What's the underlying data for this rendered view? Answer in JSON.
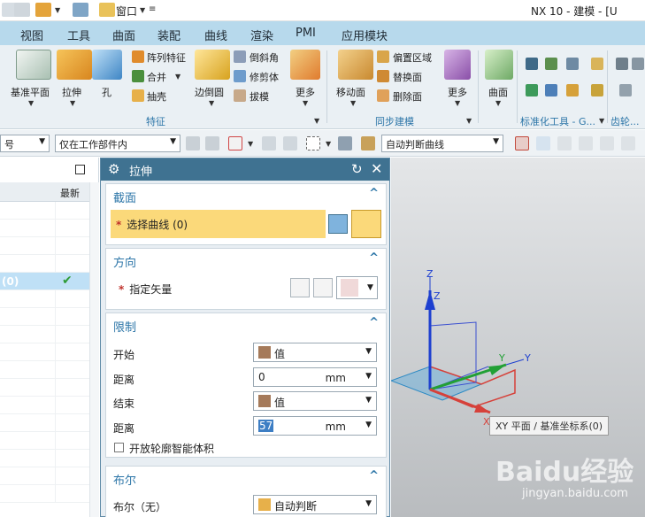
{
  "window": {
    "title": "NX 10 - 建模 - [U",
    "quick_access_window_label": "窗口"
  },
  "tabs": [
    "视图",
    "工具",
    "曲面",
    "装配",
    "曲线",
    "渲染",
    "PMI",
    "应用模块"
  ],
  "ribbon": {
    "datum_plane": "基准平面",
    "extrude": "拉伸",
    "hole": "孔",
    "pattern_feature": "阵列特征",
    "unite": "合并",
    "shell": "抽壳",
    "edge_blend": "边倒圆",
    "chamfer": "倒斜角",
    "trim_body": "修剪体",
    "draft": "拔模",
    "more1": "更多",
    "move_face": "移动面",
    "offset_region": "偏置区域",
    "replace_face": "替换面",
    "delete_face": "删除面",
    "more2": "更多",
    "surface": "曲面",
    "group_feature": "特征",
    "group_sync": "同步建模",
    "group_std": "标准化工具 - G...",
    "group_gear": "齿轮..."
  },
  "selection_bar": {
    "filter_left": "号",
    "scope": "仅在工作部件内",
    "curve_rule": "自动判断曲线"
  },
  "navigator": {
    "col_latest": "最新",
    "selected_row_text": "(0)"
  },
  "dialog": {
    "title": "拉伸",
    "section_profile": "截面",
    "select_curve": "选择曲线 (0)",
    "section_direction": "方向",
    "specify_vector": "指定矢量",
    "section_limits": "限制",
    "start_label": "开始",
    "start_value": "值",
    "distance_label": "距离",
    "start_distance": "0",
    "unit": "mm",
    "end_label": "结束",
    "end_value": "值",
    "end_distance": "57",
    "open_profile": "开放轮廓智能体积",
    "section_boolean": "布尔",
    "boolean_label": "布尔（无）",
    "boolean_value": "自动判断"
  },
  "viewport": {
    "axis_z1": "Z",
    "axis_z2": "Z",
    "axis_y1": "Y",
    "axis_y2": "Y",
    "axis_x": "X",
    "tooltip": "XY 平面 / 基准坐标系(0)",
    "watermark": "Baidu经验",
    "watermark_sub": "jingyan.baidu.com"
  },
  "colors": {
    "tab_bar": "#b7d9ec",
    "dialog_title": "#3f7291",
    "accent": "#2d76a8",
    "highlight": "#fbd97a",
    "selection_row": "#bfe0f6"
  }
}
